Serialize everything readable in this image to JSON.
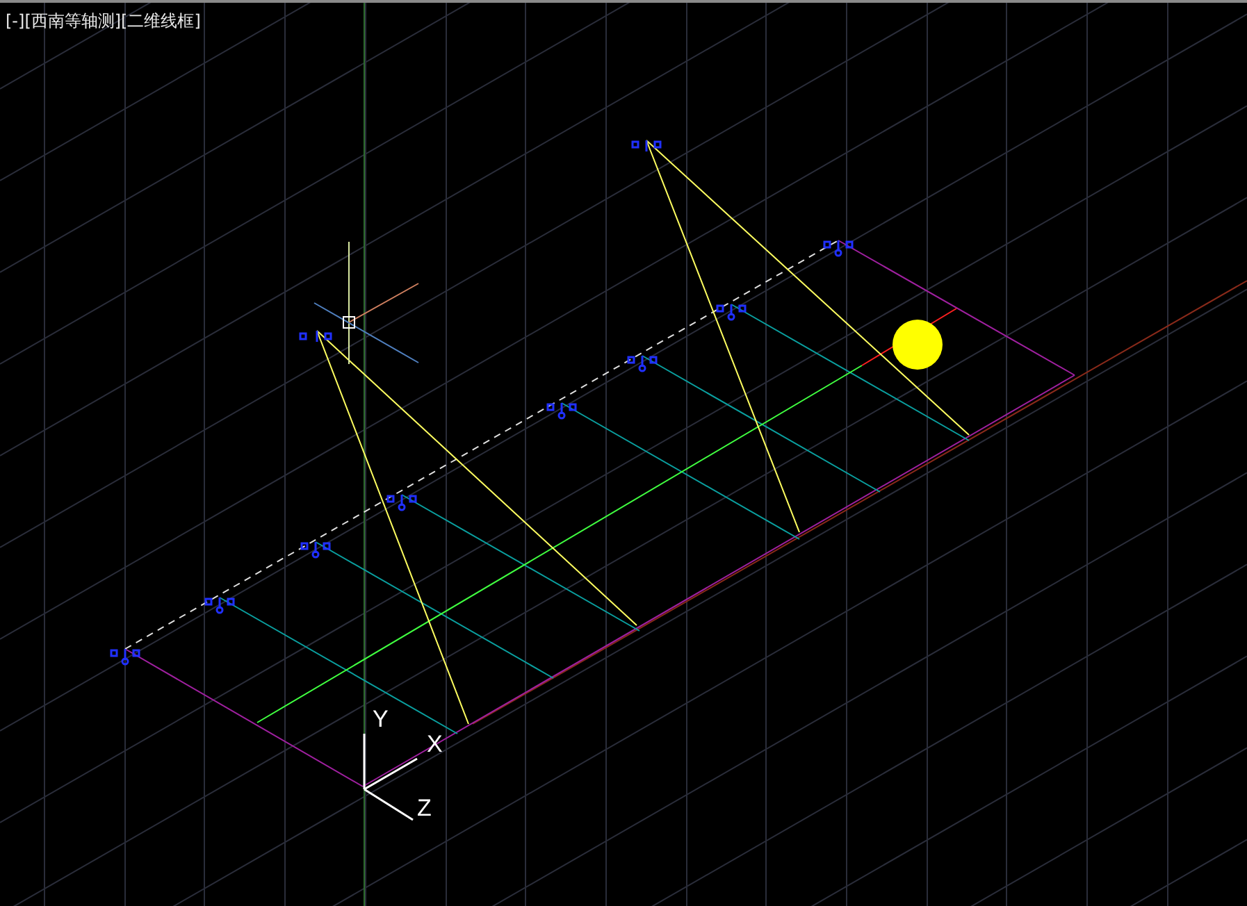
{
  "viewport": {
    "label": "[-][西南等轴测][二维线框]"
  },
  "ucs_axes": [
    {
      "kind": "y",
      "label": "Y"
    },
    {
      "kind": "x",
      "label": "X"
    },
    {
      "kind": "z",
      "label": "Z"
    }
  ]
}
